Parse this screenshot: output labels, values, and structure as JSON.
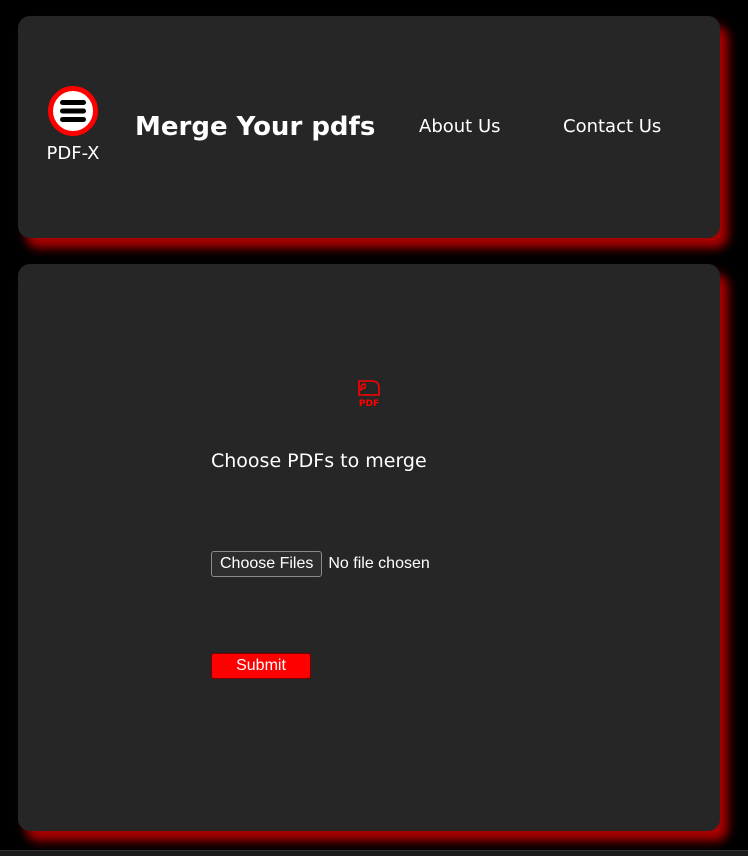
{
  "header": {
    "logo_icon": "menu-bars-icon",
    "logo_label": "PDF-X",
    "title": "Merge Your pdfs",
    "nav": [
      {
        "label": "About Us"
      },
      {
        "label": "Contact Us"
      }
    ]
  },
  "main": {
    "icon": "pdf-file-icon",
    "icon_text": "PDF",
    "heading": "Choose PDFs to merge",
    "file_input": {
      "button_label": "Choose Files",
      "status": "No file chosen"
    },
    "submit_label": "Submit"
  },
  "colors": {
    "background": "#000000",
    "card": "#262626",
    "accent": "#ff0000",
    "shadow": "#c80000",
    "text": "#ffffff"
  }
}
